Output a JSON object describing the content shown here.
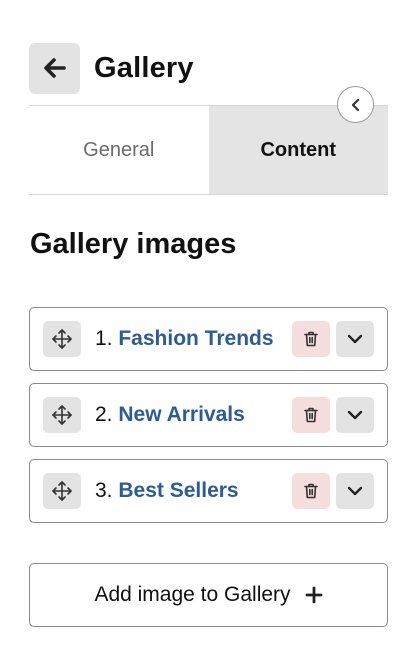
{
  "header": {
    "title": "Gallery",
    "back_icon": "arrow-left-icon"
  },
  "tabs": [
    {
      "label": "General",
      "active": false
    },
    {
      "label": "Content",
      "active": true
    }
  ],
  "collapse_icon": "chevron-left-icon",
  "section": {
    "heading": "Gallery images"
  },
  "images": [
    {
      "number": "1.",
      "title": "Fashion Trends"
    },
    {
      "number": "2.",
      "title": "New Arrivals"
    },
    {
      "number": "3.",
      "title": "Best Sellers"
    }
  ],
  "item_icons": {
    "drag": "move-icon",
    "delete": "trash-icon",
    "expand": "chevron-down-icon"
  },
  "add_button": {
    "label": "Add image to Gallery",
    "icon": "plus-icon"
  },
  "colors": {
    "link": "#2d5c95",
    "delete_bg": "#f6dede",
    "button_bg": "#e3e3e3",
    "active_tab_bg": "#e4e4e4"
  }
}
